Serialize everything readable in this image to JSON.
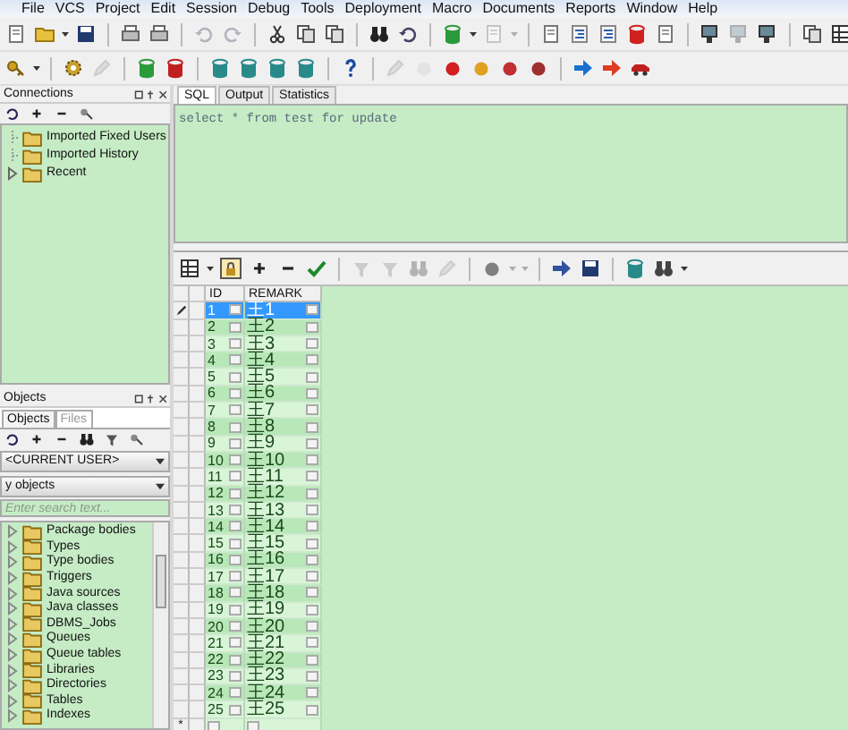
{
  "menu_bar": [
    "File",
    "VCS",
    "Project",
    "Edit",
    "Session",
    "Debug",
    "Tools",
    "Deployment",
    "Macro",
    "Documents",
    "Reports",
    "Window",
    "Help"
  ],
  "connections": {
    "title": "Connections",
    "items": [
      {
        "label": "Imported Fixed Users",
        "expandable": false
      },
      {
        "label": "Imported History",
        "expandable": false
      },
      {
        "label": "Recent",
        "expandable": true
      }
    ]
  },
  "objects": {
    "title": "Objects",
    "tabs": [
      {
        "label": "Objects",
        "selected": true
      },
      {
        "label": "Files",
        "selected": false
      }
    ],
    "user_filter": "<CURRENT USER>",
    "object_filter": "y objects",
    "search": {
      "placeholder": "Enter search text..."
    },
    "items": [
      {
        "label": "Package bodies"
      },
      {
        "label": "Types"
      },
      {
        "label": "Type bodies"
      },
      {
        "label": "Triggers"
      },
      {
        "label": "Java sources"
      },
      {
        "label": "Java classes"
      },
      {
        "label": "DBMS_Jobs"
      },
      {
        "label": "Queues"
      },
      {
        "label": "Queue tables"
      },
      {
        "label": "Libraries"
      },
      {
        "label": "Directories"
      },
      {
        "label": "Tables"
      },
      {
        "label": "Indexes"
      }
    ]
  },
  "editor_tabs": [
    {
      "label": "SQL",
      "selected": true
    },
    {
      "label": "Output",
      "selected": false
    },
    {
      "label": "Statistics",
      "selected": false
    }
  ],
  "sql_text": "select * from test for update",
  "grid": {
    "columns": [
      "ID",
      "REMARK"
    ],
    "new_row_marker": "*",
    "rows": [
      {
        "id": "1",
        "remark": "王1",
        "selected": true
      },
      {
        "id": "2",
        "remark": "王2",
        "selected": false
      },
      {
        "id": "3",
        "remark": "王3",
        "selected": false
      },
      {
        "id": "4",
        "remark": "王4",
        "selected": false
      },
      {
        "id": "5",
        "remark": "王5",
        "selected": false
      },
      {
        "id": "6",
        "remark": "王6",
        "selected": false
      },
      {
        "id": "7",
        "remark": "王7",
        "selected": false
      },
      {
        "id": "8",
        "remark": "王8",
        "selected": false
      },
      {
        "id": "9",
        "remark": "王9",
        "selected": false
      },
      {
        "id": "10",
        "remark": "王10",
        "selected": false
      },
      {
        "id": "11",
        "remark": "王11",
        "selected": false
      },
      {
        "id": "12",
        "remark": "王12",
        "selected": false
      },
      {
        "id": "13",
        "remark": "王13",
        "selected": false
      },
      {
        "id": "14",
        "remark": "王14",
        "selected": false
      },
      {
        "id": "15",
        "remark": "王15",
        "selected": false
      },
      {
        "id": "16",
        "remark": "王16",
        "selected": false
      },
      {
        "id": "17",
        "remark": "王17",
        "selected": false
      },
      {
        "id": "18",
        "remark": "王18",
        "selected": false
      },
      {
        "id": "19",
        "remark": "王19",
        "selected": false
      },
      {
        "id": "20",
        "remark": "王20",
        "selected": false
      },
      {
        "id": "21",
        "remark": "王21",
        "selected": false
      },
      {
        "id": "22",
        "remark": "王22",
        "selected": false
      },
      {
        "id": "23",
        "remark": "王23",
        "selected": false
      },
      {
        "id": "24",
        "remark": "王24",
        "selected": false
      },
      {
        "id": "25",
        "remark": "王25",
        "selected": false
      }
    ]
  }
}
